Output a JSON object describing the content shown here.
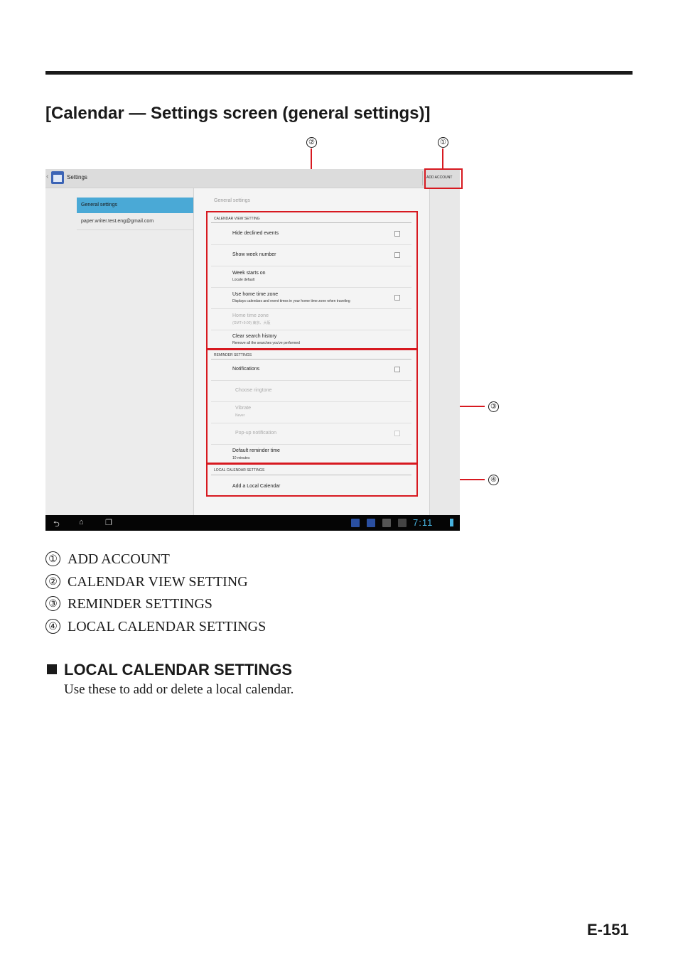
{
  "page": {
    "title": "[Calendar — Settings screen (general settings)]",
    "page_number": "E-151"
  },
  "callouts": [
    "①",
    "②",
    "③",
    "④"
  ],
  "screenshot": {
    "action_bar": {
      "back": "‹",
      "title": "Settings",
      "add_account": "ADD ACCOUNT"
    },
    "left_nav": {
      "selected": "General settings",
      "account": "paper.writer.test.eng@gmail.com"
    },
    "right": {
      "header": "General settings",
      "calendar_view": {
        "heading": "CALENDAR VIEW SETTING",
        "rows": [
          {
            "title": "Hide declined events",
            "sub": ""
          },
          {
            "title": "Show week number",
            "sub": ""
          },
          {
            "title": "Week starts on",
            "sub": "Locale default"
          },
          {
            "title": "Use home time zone",
            "sub": "Displays calendars and event times in your home time zone when traveling"
          },
          {
            "title": "Home time zone",
            "sub": "(GMT+9:00) 東京、大阪"
          },
          {
            "title": "Clear search history",
            "sub": "Remove all the searches you've performed"
          }
        ]
      },
      "reminder": {
        "heading": "REMINDER SETTINGS",
        "rows": [
          {
            "title": "Notifications",
            "sub": ""
          },
          {
            "title": "Choose ringtone",
            "sub": ""
          },
          {
            "title": "Vibrate",
            "sub": "Never"
          },
          {
            "title": "Pop-up notification",
            "sub": ""
          },
          {
            "title": "Default reminder time",
            "sub": "10 minutes"
          }
        ]
      },
      "local": {
        "heading": "LOCAL CALENDAR SETTINGS",
        "rows": [
          {
            "title": "Add a Local Calendar",
            "sub": ""
          }
        ]
      }
    },
    "nav_bar": {
      "clock": "7:11"
    }
  },
  "legend": [
    {
      "num": "①",
      "label": "ADD ACCOUNT"
    },
    {
      "num": "②",
      "label": "CALENDAR VIEW SETTING"
    },
    {
      "num": "③",
      "label": "REMINDER SETTINGS"
    },
    {
      "num": "④",
      "label": "LOCAL CALENDAR SETTINGS"
    }
  ],
  "section": {
    "heading": "LOCAL CALENDAR SETTINGS",
    "text": "Use these to add or delete a local calendar."
  }
}
